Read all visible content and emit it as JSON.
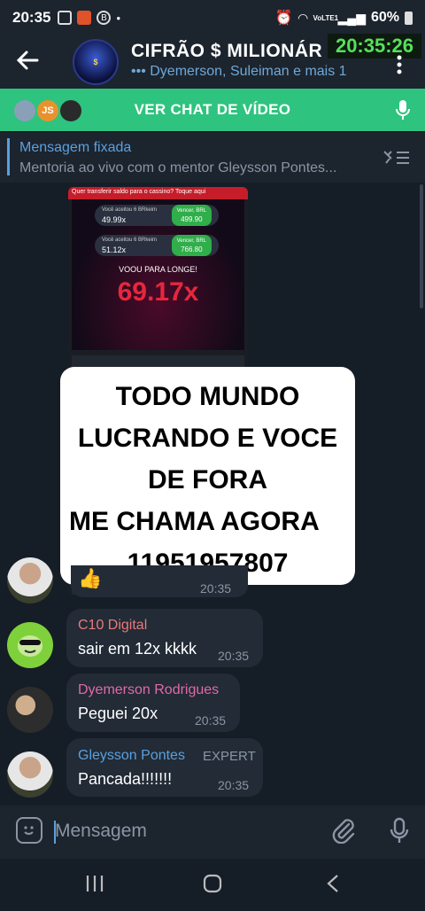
{
  "status": {
    "time": "20:35",
    "network": "VoLTE1",
    "battery": "60%",
    "icons": [
      "screen-record-icon",
      "app-icon",
      "b-icon",
      "dot-icon",
      "alarm-icon",
      "wifi-icon",
      "signal-icon",
      "battery-icon"
    ]
  },
  "header": {
    "title": "CIFRÃO $ MILIONÁR",
    "subtitle": "••• Dyemerson, Suleiman e mais 1",
    "recording_time": "20:35:26"
  },
  "video_chat": {
    "label": "VER CHAT DE VÍDEO",
    "avatar_label": "JS"
  },
  "pinned": {
    "title": "Mensagem fixada",
    "text": "Mentoria ao vivo com o mentor  Gleysson Pontes..."
  },
  "media": {
    "banner": "Quer transferir saldo para o cassino?  Toque aqui",
    "bet1_label": "Você aceitou 6 BRkeim",
    "bet1_mult": "49.99x",
    "bet1_win_label": "Vencer, BRL",
    "bet1_win": "499.90",
    "bet2_label": "Você aceitou 6 BRkeim",
    "bet2_mult": "51.12x",
    "bet2_win_label": "Vencer, BRL",
    "bet2_win": "766.80",
    "flew": "VOOU PARA LONGE!",
    "multiplier": "69.17x"
  },
  "overlay": {
    "line1": "TODO MUNDO",
    "line2": "LUCRANDO E VOCE",
    "line3": "DE FORA",
    "line4": "ME CHAMA AGORA",
    "line5": "11951957807"
  },
  "reaction": {
    "emoji": "👍",
    "time": "20:35"
  },
  "messages": [
    {
      "name": "C10 Digital",
      "text": "sair em 12x kkkk",
      "time": "20:35",
      "name_color": "#e87a7a"
    },
    {
      "name": "Dyemerson Rodrigues",
      "text": "Peguei 20x",
      "time": "20:35",
      "name_color": "#e06aa8"
    },
    {
      "name": "Gleysson Pontes",
      "badge": "EXPERT",
      "text": "Pancada!!!!!!!",
      "time": "20:35",
      "name_color": "#5aa0e0"
    }
  ],
  "composer": {
    "placeholder": "Mensagem"
  },
  "nav": {
    "recents": "|||",
    "home": "◯",
    "back": "<"
  },
  "colors": {
    "accent": "#2ec37f",
    "link": "#5aa0e0",
    "background": "#151d27",
    "surface": "#1c242e",
    "bubble": "#222b36"
  }
}
